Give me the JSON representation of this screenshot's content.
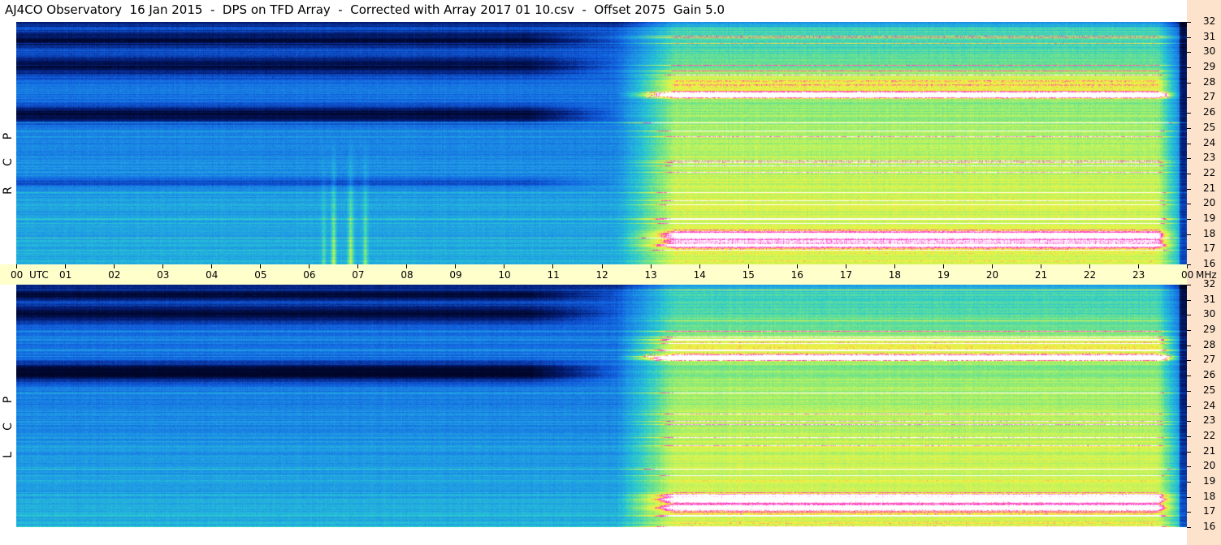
{
  "title": "AJ4CO Observatory  16 Jan 2015  -  DPS on TFD Array  -  Corrected with Array 2017 01 10.csv  -  Offset 2075  Gain 5.0",
  "chart_data": {
    "type": "heatmap",
    "title": "AJ4CO Observatory  16 Jan 2015  -  DPS on TFD Array  -  Corrected with Array 2017 01 10.csv  -  Offset 2075  Gain 5.0",
    "x_axis": {
      "label": "UTC",
      "ticks": [
        "00",
        "01",
        "02",
        "03",
        "04",
        "05",
        "06",
        "07",
        "08",
        "09",
        "10",
        "11",
        "12",
        "13",
        "14",
        "15",
        "16",
        "17",
        "18",
        "19",
        "20",
        "21",
        "22",
        "23",
        "00"
      ],
      "range": [
        0,
        24
      ]
    },
    "y_axis": {
      "label": "MHz",
      "ticks": [
        "32",
        "31",
        "30",
        "29",
        "28",
        "27",
        "26",
        "25",
        "24",
        "23",
        "22",
        "21",
        "20",
        "19",
        "18",
        "17",
        "16"
      ],
      "range": [
        16,
        32
      ]
    },
    "panels": [
      {
        "label_letters": [
          "P",
          "C",
          "R"
        ]
      },
      {
        "label_letters": [
          "P",
          "C",
          "L"
        ]
      }
    ],
    "colors": {
      "quiet_dark": "#000a40",
      "background": "#1a6fe0",
      "mid": "#22c4d8",
      "active": "#b8f060",
      "hot": "#ffffff",
      "magenta": "#ff20d0",
      "axis_bg": "#ffffcc",
      "strip_bg": "#fde3cc"
    }
  }
}
